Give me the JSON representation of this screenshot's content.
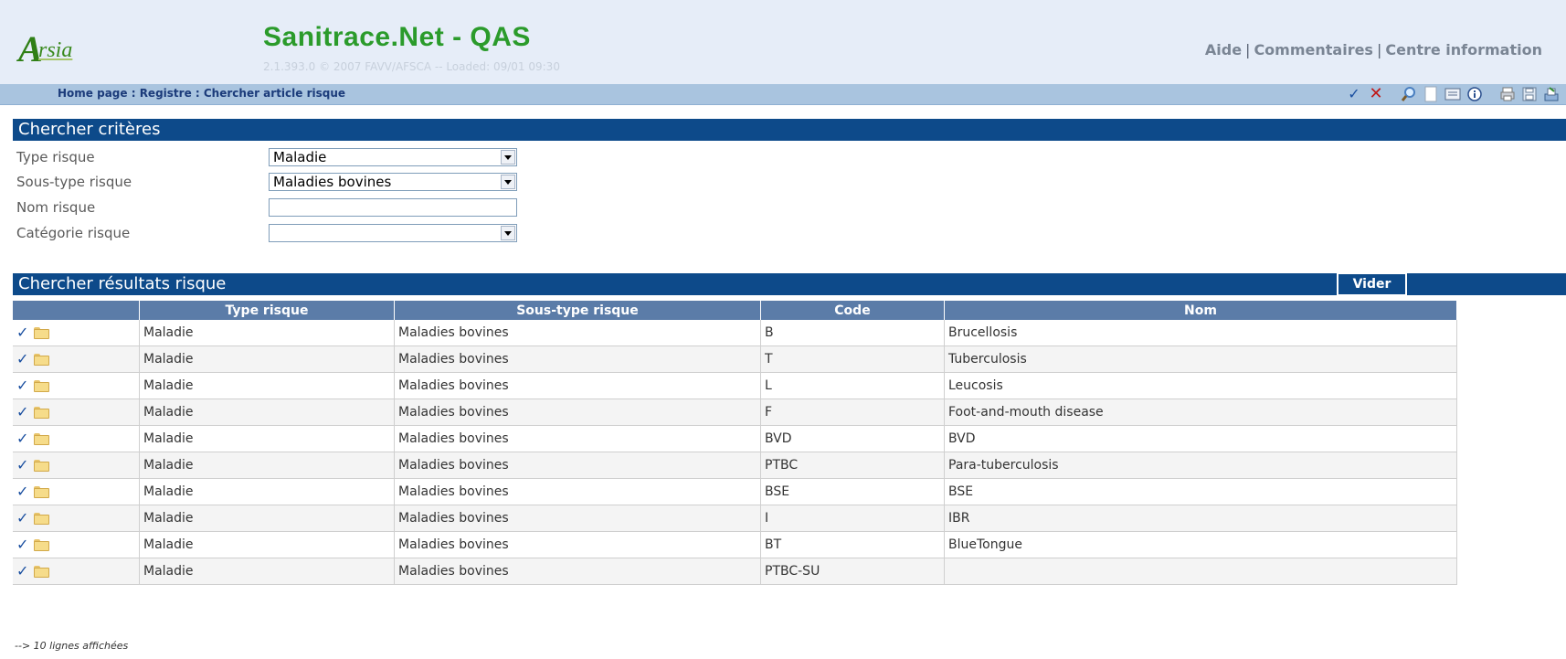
{
  "header": {
    "logo_letter": "A",
    "logo_text": "rsia",
    "title": "Sanitrace.Net - QAS",
    "subtitle": "2.1.393.0 © 2007 FAVV/AFSCA -- Loaded: 09/01 09:30",
    "links": [
      "Aide",
      "Commentaires",
      "Centre information"
    ]
  },
  "breadcrumb": {
    "items": [
      "Home page",
      "Registre",
      "Chercher article risque"
    ],
    "separator": " : "
  },
  "toolbar": {
    "icons": [
      "check-icon",
      "delete-icon",
      "search-icon",
      "new-document-icon",
      "list-icon",
      "info-icon",
      "print-icon",
      "save-icon",
      "export-icon"
    ]
  },
  "criteria": {
    "title": "Chercher critères",
    "fields": [
      {
        "label": "Type risque",
        "value": "Maladie"
      },
      {
        "label": "Sous-type risque",
        "value": "Maladies bovines"
      },
      {
        "label": "Nom risque",
        "value": ""
      },
      {
        "label": "Catégorie risque",
        "value": ""
      }
    ]
  },
  "results": {
    "title": "Chercher résultats risque",
    "clear_label": "Vider",
    "columns": [
      "",
      "Type risque",
      "Sous-type risque",
      "Code",
      "Nom"
    ],
    "rows": [
      {
        "type": "Maladie",
        "subtype": "Maladies bovines",
        "code": "B",
        "name": "Brucellosis"
      },
      {
        "type": "Maladie",
        "subtype": "Maladies bovines",
        "code": "T",
        "name": "Tuberculosis"
      },
      {
        "type": "Maladie",
        "subtype": "Maladies bovines",
        "code": "L",
        "name": "Leucosis"
      },
      {
        "type": "Maladie",
        "subtype": "Maladies bovines",
        "code": "F",
        "name": "Foot-and-mouth disease"
      },
      {
        "type": "Maladie",
        "subtype": "Maladies bovines",
        "code": "BVD",
        "name": "BVD"
      },
      {
        "type": "Maladie",
        "subtype": "Maladies bovines",
        "code": "PTBC",
        "name": "Para-tuberculosis"
      },
      {
        "type": "Maladie",
        "subtype": "Maladies bovines",
        "code": "BSE",
        "name": "BSE"
      },
      {
        "type": "Maladie",
        "subtype": "Maladies bovines",
        "code": "I",
        "name": "IBR"
      },
      {
        "type": "Maladie",
        "subtype": "Maladies bovines",
        "code": "BT",
        "name": "BlueTongue"
      },
      {
        "type": "Maladie",
        "subtype": "Maladies bovines",
        "code": "PTBC-SU",
        "name": ""
      }
    ],
    "footer": "--> 10 lignes affichées"
  },
  "colors": {
    "header_bg": "#e6edf8",
    "crumb_bg": "#a9c4df",
    "section_bg": "#0d4a8a",
    "table_header_bg": "#5b7ca8",
    "title_green": "#2b9b2b"
  }
}
